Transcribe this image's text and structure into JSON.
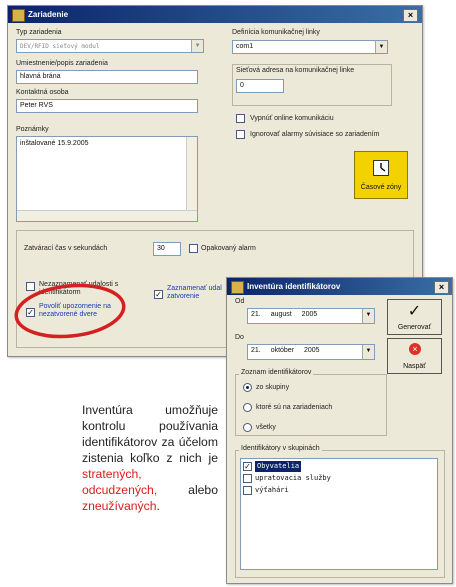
{
  "zariadenie": {
    "title": "Zariadenie",
    "close": "×",
    "typ_label": "Typ zariadenia",
    "typ_value": "DEV/RFID sieťový modul",
    "umiestnenie_label": "Umiestnenie/popis zariadenia",
    "umiestnenie_value": "hlavná brána",
    "kontakt_label": "Kontaktná osoba",
    "kontakt_value": "Peter RVS",
    "poznamky_label": "Poznámky",
    "poznamky_value": "inštalované 15.9.2005",
    "definicia_label": "Definícia komunikačnej linky",
    "definicia_value": "com1",
    "sietova_label": "Sieťová adresa na komunikačnej linke",
    "sietova_value": "0",
    "vypnut_label": "Vypnúť online komunikáciu",
    "ignorovat_label": "Ignorovať alarmy súvisiace so zariadením",
    "casove_label": "Časové zóny",
    "zatvaraci_label": "Zatvárací čas v sekundách",
    "zatvaraci_value": "30",
    "opakovany_label": "Opakovaný alarm",
    "nezaznamenat_label": "Nezaznamenať udalosti s identifikátorm",
    "povolit_label": "Povoliť upozornenie na nezatvorené dvere",
    "zaznamenat_label": "Zaznamenať udal zatvorenie"
  },
  "inventura": {
    "title": "Inventúra identifikátorov",
    "close": "×",
    "od_label": "Od",
    "od_day": "21.",
    "od_month": "august",
    "od_year": "2005",
    "do_label": "Do",
    "do_day": "21.",
    "do_month": "október",
    "do_year": "2005",
    "generovat_label": "Generovať",
    "naspat_label": "Naspäť",
    "zoznam_label": "Zoznam identifikátorov",
    "radio_options": [
      "zo skupiny",
      "ktoré sú na zariadeniach",
      "všetky"
    ],
    "skupiny_label": "Identifikátory v skupinách",
    "skupiny": [
      "Obyvatelia",
      "upratovacia služby",
      "výťahári"
    ]
  },
  "prose": {
    "part1": "Inventúra umožňuje kontrolu používania identifikátorov za účelom zistenia koľko z nich je",
    "red1": "stratených,",
    "red2": "odcudzených,",
    "part2": "alebo",
    "red3": "zneužívaných",
    "end": "."
  },
  "colors": {
    "titlebar": "#0a246a",
    "highlight": "#d42020",
    "zone_button": "#f2d200"
  }
}
